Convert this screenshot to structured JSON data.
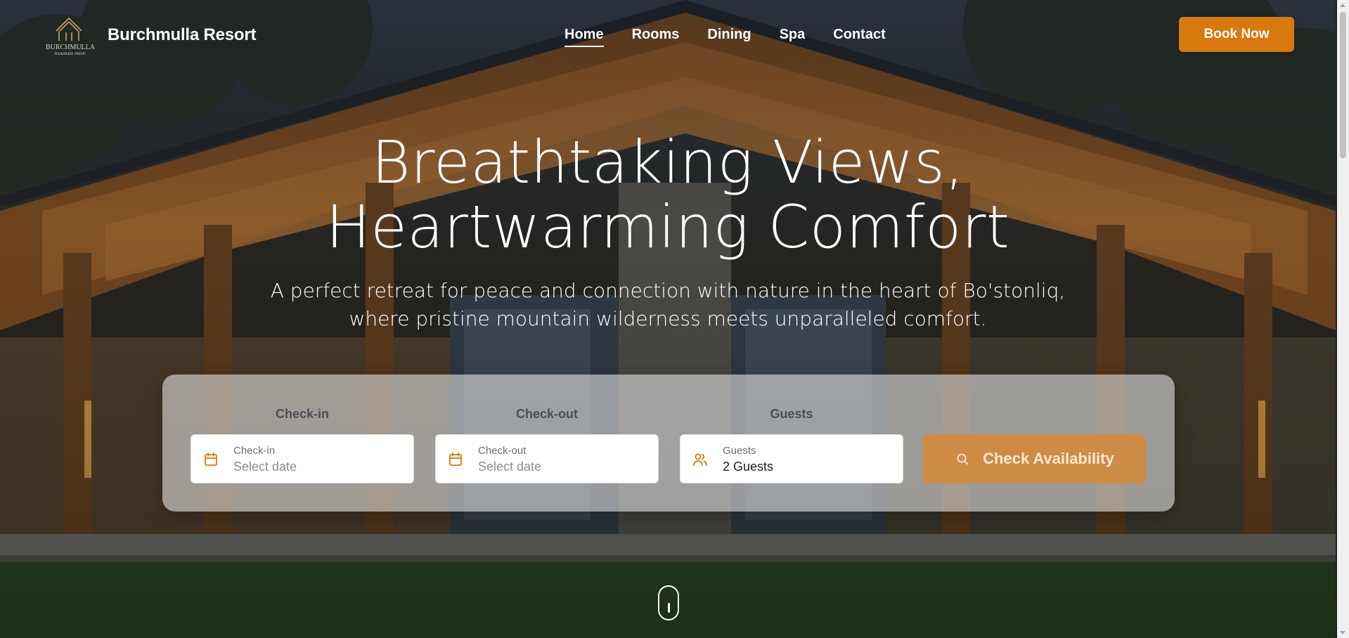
{
  "brand": {
    "name": "Burchmulla Resort",
    "logo_text": "BURCHMULLA",
    "logo_subtext": "mountain resort"
  },
  "nav": {
    "items": [
      {
        "label": "Home",
        "active": true
      },
      {
        "label": "Rooms",
        "active": false
      },
      {
        "label": "Dining",
        "active": false
      },
      {
        "label": "Spa",
        "active": false
      },
      {
        "label": "Contact",
        "active": false
      }
    ],
    "cta_label": "Book Now"
  },
  "hero": {
    "title_line1": "Breathtaking Views,",
    "title_line2": "Heartwarming Comfort",
    "subtitle": "A perfect retreat for peace and connection with nature in the heart of Bo'stonliq, where pristine mountain wilderness meets unparalleled comfort."
  },
  "booking": {
    "checkin": {
      "heading": "Check-in",
      "label": "Check-in",
      "placeholder": "Select date",
      "icon": "calendar-icon"
    },
    "checkout": {
      "heading": "Check-out",
      "label": "Check-out",
      "placeholder": "Select date",
      "icon": "calendar-icon"
    },
    "guests": {
      "heading": "Guests",
      "label": "Guests",
      "value": "2 Guests",
      "icon": "users-icon"
    },
    "submit_label": "Check Availability",
    "submit_icon": "search-icon"
  },
  "colors": {
    "accent": "#d9780e",
    "accent_muted": "#cf8c45",
    "icon_accent": "#d9780e",
    "logo_gold": "#c9a35a"
  }
}
